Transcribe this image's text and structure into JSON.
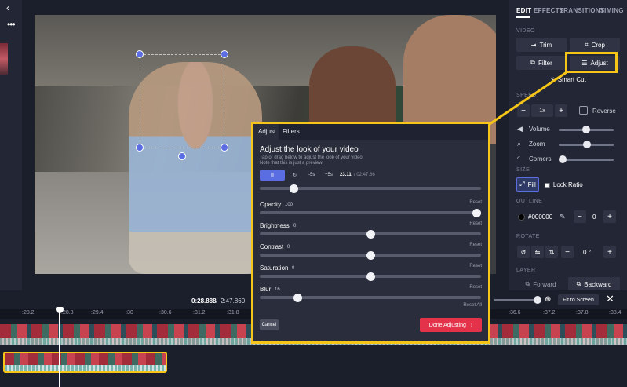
{
  "time": {
    "current": "0:28.888",
    "separator": "/",
    "total": "2:47.860"
  },
  "panel": {
    "tabs": [
      "EDIT",
      "EFFECTS",
      "TRANSITIONS",
      "TIMING"
    ],
    "video_label": "VIDEO",
    "trim": "Trim",
    "crop": "Crop",
    "filter": "Filter",
    "adjust": "Adjust",
    "smart_cut": "Smart Cut",
    "speed_label": "SPEED",
    "speed_value": "1x",
    "reverse": "Reverse",
    "volume": "Volume",
    "zoom": "Zoom",
    "corners": "Corners",
    "size_label": "SIZE",
    "fill": "Fill",
    "lock_ratio": "Lock Ratio",
    "outline_label": "OUTLINE",
    "outline_color": "#000000",
    "outline_value": "0",
    "rotate_label": "ROTATE",
    "rotate_value": "0",
    "layer_label": "LAYER",
    "forward": "Forward",
    "backward": "Backward"
  },
  "timeline": {
    "fit_to_screen": "Fit to Screen",
    "ticks": [
      ":28.2",
      ":28.8",
      ":29.4",
      ":30",
      ":30.6",
      ":31.2",
      ":31.8",
      ":36.6",
      ":37.2",
      ":37.8",
      ":38.4"
    ],
    "zoom_level": 0.92
  },
  "popup": {
    "tab_adjust": "Adjust",
    "tab_filters": "Filters",
    "title": "Adjust the look of your video",
    "subtitle_1": "Tap or drag below to adjust the look of your video.",
    "subtitle_2": "Note that this is just a preview.",
    "play_icon": "II",
    "rewind": "↻",
    "back5": "-5s",
    "fwd5": "+5s",
    "current_time": "23.11",
    "total_time": "/ 02:47.86",
    "scrub_position": 0.14,
    "sliders": [
      {
        "label": "Opacity",
        "value": "100",
        "reset": "Reset",
        "position": 1.0
      },
      {
        "label": "Brightness",
        "value": "0",
        "reset": "Reset",
        "position": 0.5
      },
      {
        "label": "Contrast",
        "value": "0",
        "reset": "Reset",
        "position": 0.5
      },
      {
        "label": "Saturation",
        "value": "0",
        "reset": "Reset",
        "position": 0.5
      },
      {
        "label": "Blur",
        "value": "16",
        "reset": "Reset",
        "position": 0.16
      }
    ],
    "reset_all": "Reset All",
    "cancel": "Cancel",
    "done": "Done Adjusting",
    "done_arrow": "›"
  },
  "colors": {
    "accent": "#5b6ee1",
    "highlight": "#f5c518",
    "done": "#e5324b"
  }
}
